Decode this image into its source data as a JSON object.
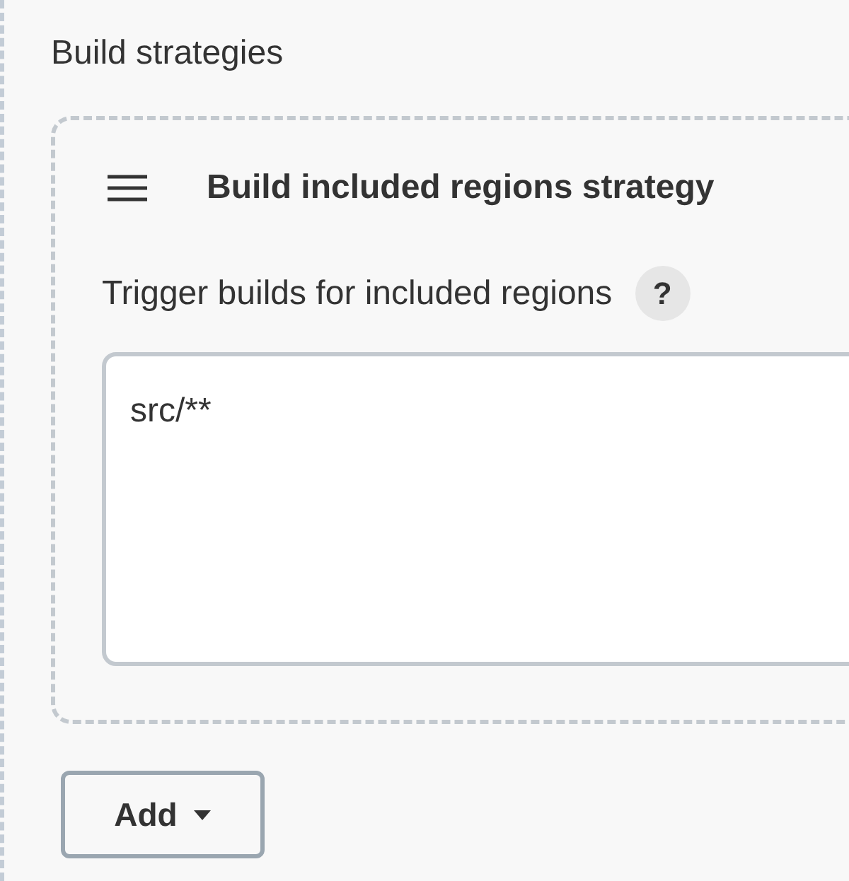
{
  "section_title": "Build strategies",
  "strategy": {
    "title": "Build included regions strategy",
    "field": {
      "label": "Trigger builds for included regions",
      "help": "?",
      "value": "src/**"
    }
  },
  "add_button": {
    "label": "Add"
  }
}
